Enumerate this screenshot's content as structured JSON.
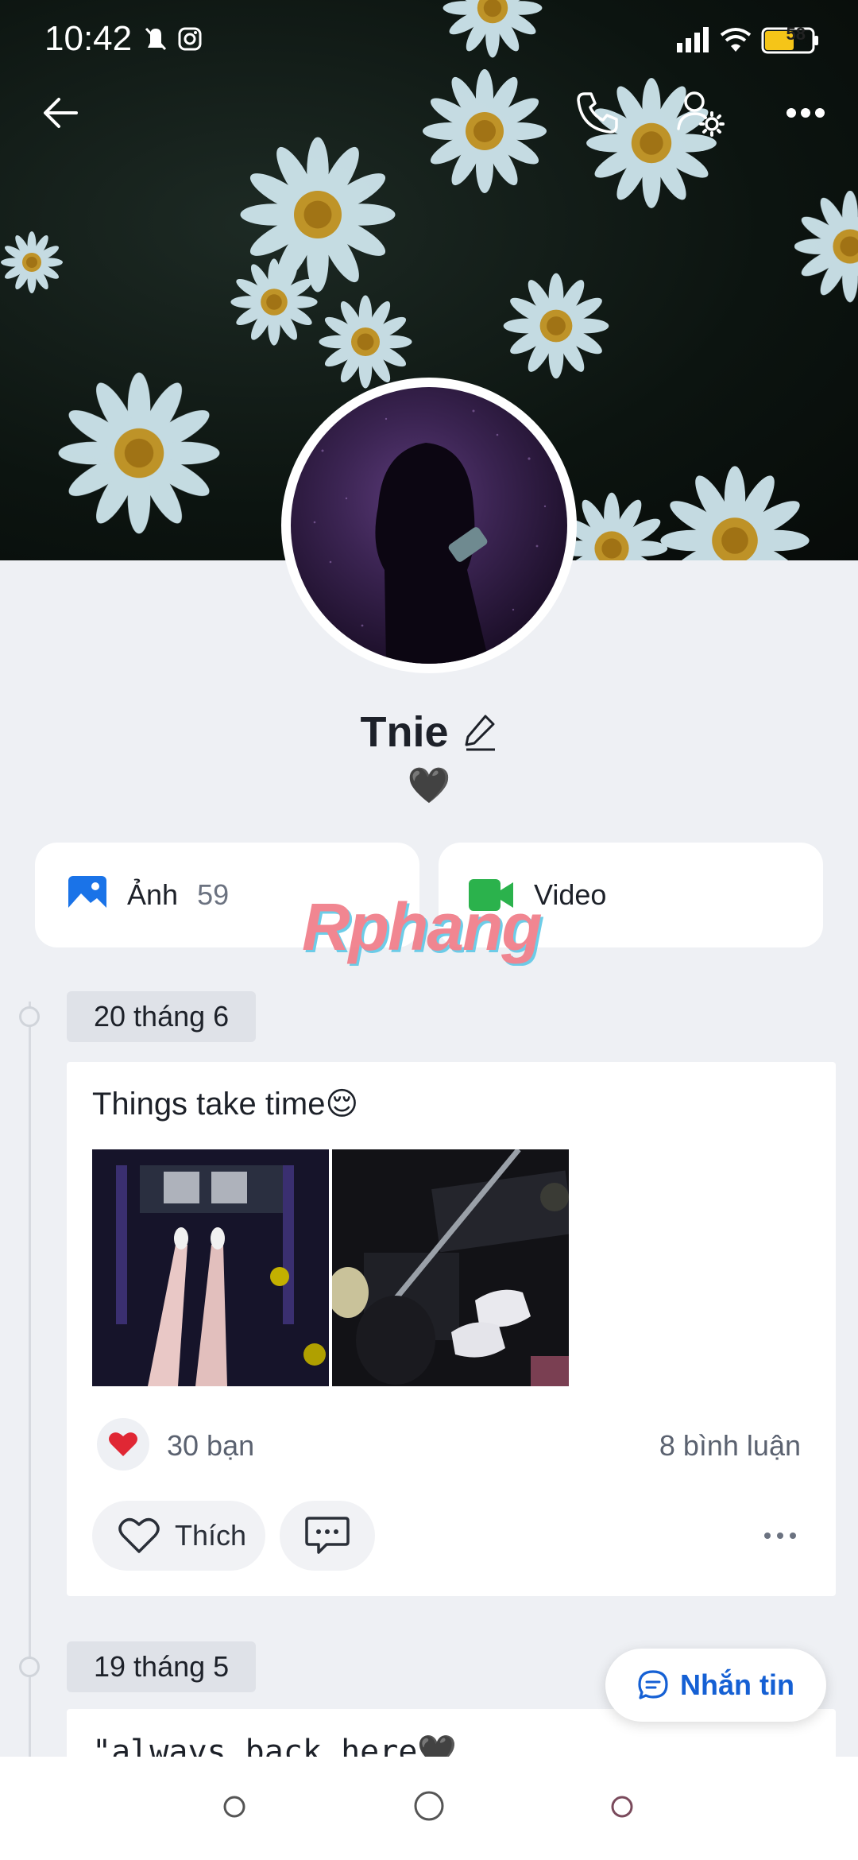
{
  "status_bar": {
    "time": "10:42",
    "battery": "58"
  },
  "header": {
    "back_icon": "arrow-left-icon",
    "call_icon": "phone-icon",
    "settings_icon": "user-gear-icon",
    "more_icon": "more-horizontal-icon"
  },
  "profile": {
    "name": "Tnie",
    "bio": "🖤"
  },
  "media": {
    "photos_label": "Ảnh",
    "photos_count": "59",
    "videos_label": "Video"
  },
  "watermark": "Rphang",
  "timeline": [
    {
      "date": "20 tháng 6",
      "text": "Things take time😌",
      "reactions": "30 bạn",
      "comments": "8 bình luận",
      "like_label": "Thích"
    },
    {
      "date": "19 tháng 5",
      "text": "\"always back here🖤"
    }
  ],
  "fab": {
    "label": "Nhắn tin"
  },
  "colors": {
    "accent": "#1560d4",
    "photos_icon": "#1a73e8",
    "video_icon": "#2bb24c",
    "heart": "#e02734"
  }
}
